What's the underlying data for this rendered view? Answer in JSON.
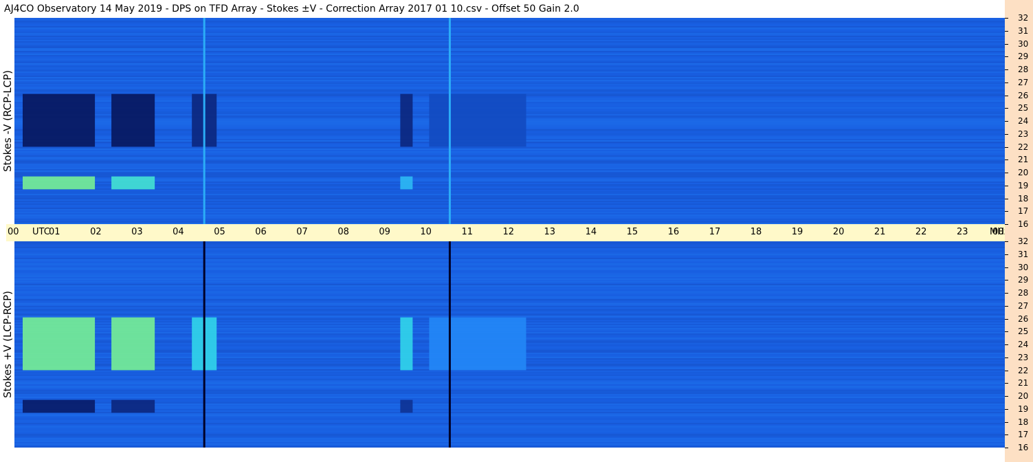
{
  "title": "AJ4CO Observatory  14 May 2019  -  DPS on TFD Array  -  Stokes ±V  -  Correction Array 2017 01 10.csv  -  Offset 50  Gain 2.0",
  "chart_data": {
    "type": "heatmap",
    "panels": [
      {
        "label": "Stokes -V (RCP-LCP)",
        "spans": [
          {
            "x0": 0.2,
            "x1": 1.95,
            "y0": 22,
            "y1": 26.1,
            "level": 0.12
          },
          {
            "x0": 2.35,
            "x1": 3.4,
            "y0": 22,
            "y1": 26.1,
            "level": 0.12
          },
          {
            "x0": 4.3,
            "x1": 4.9,
            "y0": 22,
            "y1": 26.1,
            "level": 0.18
          },
          {
            "x0": 9.35,
            "x1": 9.65,
            "y0": 22,
            "y1": 26.1,
            "level": 0.18
          },
          {
            "x0": 10.05,
            "x1": 12.4,
            "y0": 22,
            "y1": 26.1,
            "level": 0.3
          },
          {
            "x0": 0.2,
            "x1": 1.95,
            "y0": 18.7,
            "y1": 19.7,
            "level": 0.78
          },
          {
            "x0": 2.35,
            "x1": 3.4,
            "y0": 18.7,
            "y1": 19.7,
            "level": 0.72
          },
          {
            "x0": 9.35,
            "x1": 9.65,
            "y0": 18.7,
            "y1": 19.7,
            "level": 0.62
          }
        ],
        "lines": [
          {
            "x": 4.6,
            "level": 0.6
          },
          {
            "x": 10.55,
            "level": 0.6
          }
        ]
      },
      {
        "label": "Stokes +V (LCP-RCP)",
        "spans": [
          {
            "x0": 0.2,
            "x1": 1.95,
            "y0": 22,
            "y1": 26.1,
            "level": 0.78
          },
          {
            "x0": 2.35,
            "x1": 3.4,
            "y0": 22,
            "y1": 26.1,
            "level": 0.78
          },
          {
            "x0": 4.3,
            "x1": 4.9,
            "y0": 22,
            "y1": 26.1,
            "level": 0.68
          },
          {
            "x0": 9.35,
            "x1": 9.65,
            "y0": 22,
            "y1": 26.1,
            "level": 0.68
          },
          {
            "x0": 10.05,
            "x1": 12.4,
            "y0": 22,
            "y1": 26.1,
            "level": 0.5
          },
          {
            "x0": 0.2,
            "x1": 1.95,
            "y0": 18.7,
            "y1": 19.7,
            "level": 0.14
          },
          {
            "x0": 2.35,
            "x1": 3.4,
            "y0": 18.7,
            "y1": 19.7,
            "level": 0.18
          },
          {
            "x0": 9.35,
            "x1": 9.65,
            "y0": 18.7,
            "y1": 19.7,
            "level": 0.22
          }
        ],
        "lines": [
          {
            "x": 4.6,
            "level": 0.0
          },
          {
            "x": 10.55,
            "level": 0.0
          }
        ]
      }
    ],
    "x_ticks": [
      "00",
      "01",
      "02",
      "03",
      "04",
      "05",
      "06",
      "07",
      "08",
      "09",
      "10",
      "11",
      "12",
      "13",
      "14",
      "15",
      "16",
      "17",
      "18",
      "19",
      "20",
      "21",
      "22",
      "23",
      "00"
    ],
    "x_unit_label": "UTC",
    "y_unit_label": "MHz",
    "x_range": [
      0,
      24
    ],
    "y_range": [
      16,
      32
    ],
    "y_ticks": [
      "32",
      "31",
      "30",
      "29",
      "28",
      "27",
      "26",
      "25",
      "24",
      "23",
      "22",
      "21",
      "20",
      "19",
      "18",
      "17",
      "16"
    ],
    "colors": {
      "background": "#1e64e6",
      "axis_bar": "#fff9c9",
      "freq_column": "#fde0c4"
    }
  }
}
